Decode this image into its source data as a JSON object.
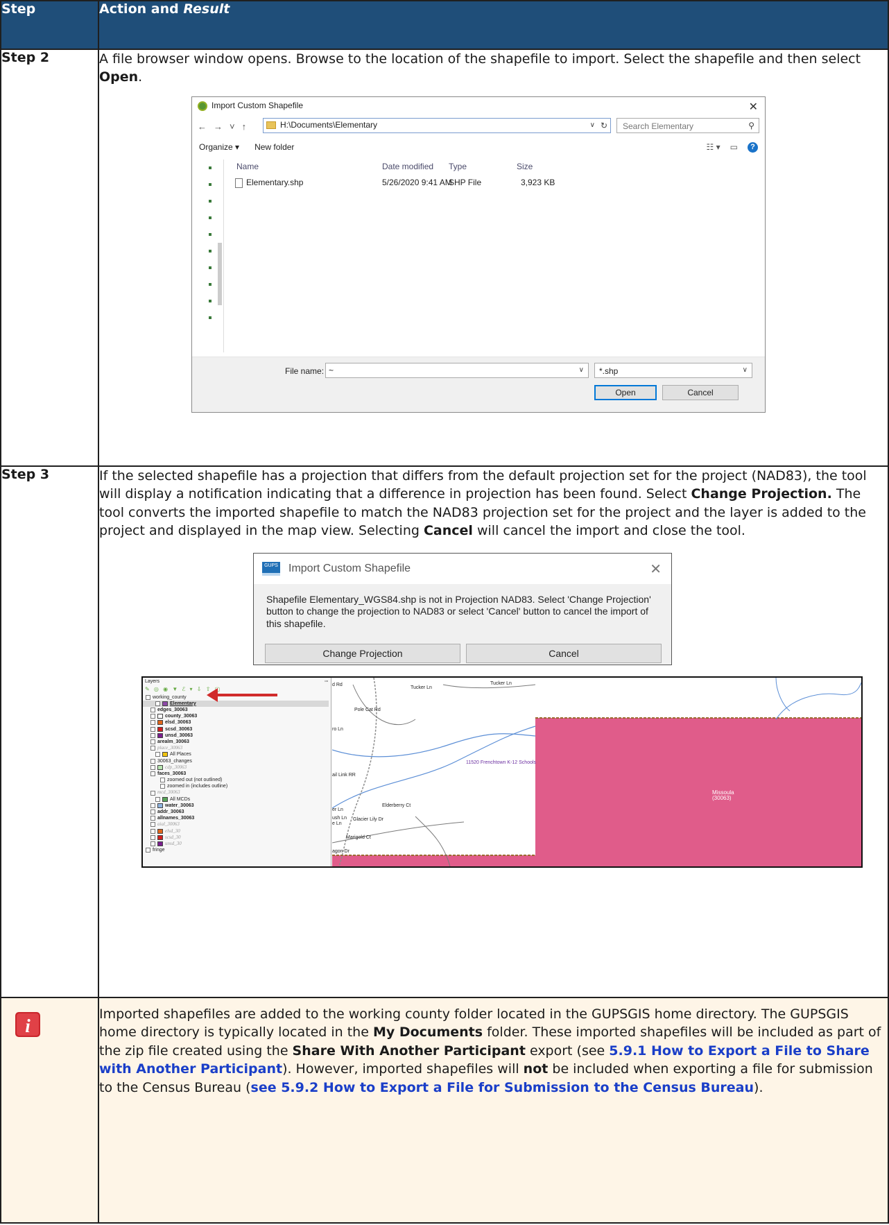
{
  "header": {
    "step": "Step",
    "action_prefix": "Action and ",
    "action_italic": "Result"
  },
  "step2": {
    "label": "Step 2",
    "text_before": "A file browser window opens. Browse to the location of the shapefile to import. Select the shapefile and then select ",
    "text_bold": "Open",
    "text_after": "."
  },
  "file_dialog": {
    "title": "Import Custom Shapefile",
    "path": "H:\\Documents\\Elementary",
    "search_placeholder": "Search Elementary",
    "organize": "Organize ▾",
    "new_folder": "New folder",
    "columns": {
      "name": "Name",
      "date": "Date modified",
      "type": "Type",
      "size": "Size"
    },
    "files": [
      {
        "name": "Elementary.shp",
        "date": "5/26/2020 9:41 AM",
        "type": "SHP File",
        "size": "3,923 KB"
      }
    ],
    "file_name_label": "File name:",
    "file_name_value": "~",
    "file_type": "*.shp",
    "open_button": "Open",
    "cancel_button": "Cancel"
  },
  "step3": {
    "label": "Step 3",
    "p1": "If the selected shapefile has a projection that differs from the default projection set for the project (NAD83), the tool will display a notification indicating that a difference in projection has been found. Select ",
    "b1": "Change Projection.",
    "p2": " The tool converts the imported shapefile to match the NAD83 projection set for the project and the layer is added to the project and displayed in the map view. Selecting ",
    "b2": "Cancel",
    "p3": " will cancel the import and close the tool."
  },
  "notify_dialog": {
    "logo": "GUPS",
    "title": "Import Custom Shapefile",
    "message": "Shapefile Elementary_WGS84.shp is not in Projection NAD83. Select 'Change Projection' button to change the projection to NAD83 or select 'Cancel' button to cancel the import of this shapefile.",
    "change_button": "Change Projection",
    "cancel_button": "Cancel"
  },
  "gis": {
    "panel_title": "Layers",
    "layers": [
      {
        "label": "working_county",
        "style": "normal",
        "indent": 0,
        "swatch": ""
      },
      {
        "label": "Elementary",
        "style": "bold-sel",
        "indent": 2,
        "swatch": "#8e4aa8"
      },
      {
        "label": "edges_30063",
        "style": "bold",
        "indent": 1,
        "swatch": ""
      },
      {
        "label": "county_30063",
        "style": "bold",
        "indent": 1,
        "swatch": "#ffffff"
      },
      {
        "label": "elsd_30063",
        "style": "bold",
        "indent": 1,
        "swatch": "#e0661b"
      },
      {
        "label": "scsd_30063",
        "style": "bold",
        "indent": 1,
        "swatch": "#d21f1f"
      },
      {
        "label": "unsd_30063",
        "style": "bold",
        "indent": 1,
        "swatch": "#7a1f8e"
      },
      {
        "label": "arealm_30063",
        "style": "bold",
        "indent": 1,
        "swatch": ""
      },
      {
        "label": "place_30063",
        "style": "gray",
        "indent": 1,
        "swatch": ""
      },
      {
        "label": "All Places",
        "style": "normal",
        "indent": 2,
        "swatch": "#f1c40f"
      },
      {
        "label": "30063_changes",
        "style": "normal",
        "indent": 1,
        "swatch": ""
      },
      {
        "label": "cdp_30063",
        "style": "gray",
        "indent": 1,
        "swatch": "#b8e6b0"
      },
      {
        "label": "faces_30063",
        "style": "bold",
        "indent": 1,
        "swatch": ""
      },
      {
        "label": "zoomed out (not outlined)",
        "style": "normal",
        "indent": 3,
        "swatch": ""
      },
      {
        "label": "zoomed in (includes outline)",
        "style": "normal",
        "indent": 3,
        "swatch": ""
      },
      {
        "label": "mcd_30063",
        "style": "gray",
        "indent": 1,
        "swatch": ""
      },
      {
        "label": "All MCDs",
        "style": "normal",
        "indent": 2,
        "swatch": "#5aa65a"
      },
      {
        "label": "water_30063",
        "style": "bold",
        "indent": 1,
        "swatch": "#8fb4e0"
      },
      {
        "label": "addr_30063",
        "style": "bold",
        "indent": 1,
        "swatch": ""
      },
      {
        "label": "allnames_30063",
        "style": "bold",
        "indent": 1,
        "swatch": ""
      },
      {
        "label": "aial_30063",
        "style": "gray",
        "indent": 1,
        "swatch": ""
      },
      {
        "label": "elsd_30",
        "style": "gray",
        "indent": 1,
        "swatch": "#e0661b"
      },
      {
        "label": "scsd_30",
        "style": "gray",
        "indent": 1,
        "swatch": "#d21f1f"
      },
      {
        "label": "unsd_30",
        "style": "gray",
        "indent": 1,
        "swatch": "#7a1f8e"
      },
      {
        "label": "fringe",
        "style": "normal",
        "indent": 0,
        "swatch": ""
      }
    ],
    "map_labels": [
      {
        "text": "Tucker Ln"
      },
      {
        "text": "Tucker Ln"
      },
      {
        "text": "Pole Cat Rd"
      },
      {
        "text": "11520 Frenchtown K-12 Schools"
      },
      {
        "text": "Missoula"
      },
      {
        "text": "(30063)"
      },
      {
        "text": "Elderberry Ct"
      },
      {
        "text": "Glacier Lily Dr"
      },
      {
        "text": "Marigold Ct"
      },
      {
        "text": "ail Link RR"
      },
      {
        "text": "ro Ln"
      },
      {
        "text": "er Ln"
      },
      {
        "text": "ush Ln"
      },
      {
        "text": "e Ln"
      },
      {
        "text": "agon Dr"
      },
      {
        "text": "d Rd"
      }
    ],
    "pink_fill": "#e05c8a"
  },
  "note": {
    "t1": "Imported shapefiles are added to the working county folder located in the GUPSGIS home directory. The GUPSGIS home directory is typically located in the ",
    "b1": "My Documents",
    "t2": " folder. These imported shapefiles will be included as part of the zip file created using the ",
    "b2": "Share With Another Participant",
    "t3": " export (see ",
    "link1": "5.9.1 How to Export a File to Share with Another Participant",
    "t4": "). However, imported shapefiles will ",
    "b3": "not",
    "t5": " be included when exporting a file for submission to the Census Bureau (",
    "link2": "see 5.9.2 How to Export a File for Submission to the Census Bureau",
    "t6": ")."
  },
  "colors": {
    "header_bg": "#1f4e79",
    "note_bg": "#fef5e7",
    "link": "#1a3ec8",
    "info_icon": "#c9262c"
  }
}
